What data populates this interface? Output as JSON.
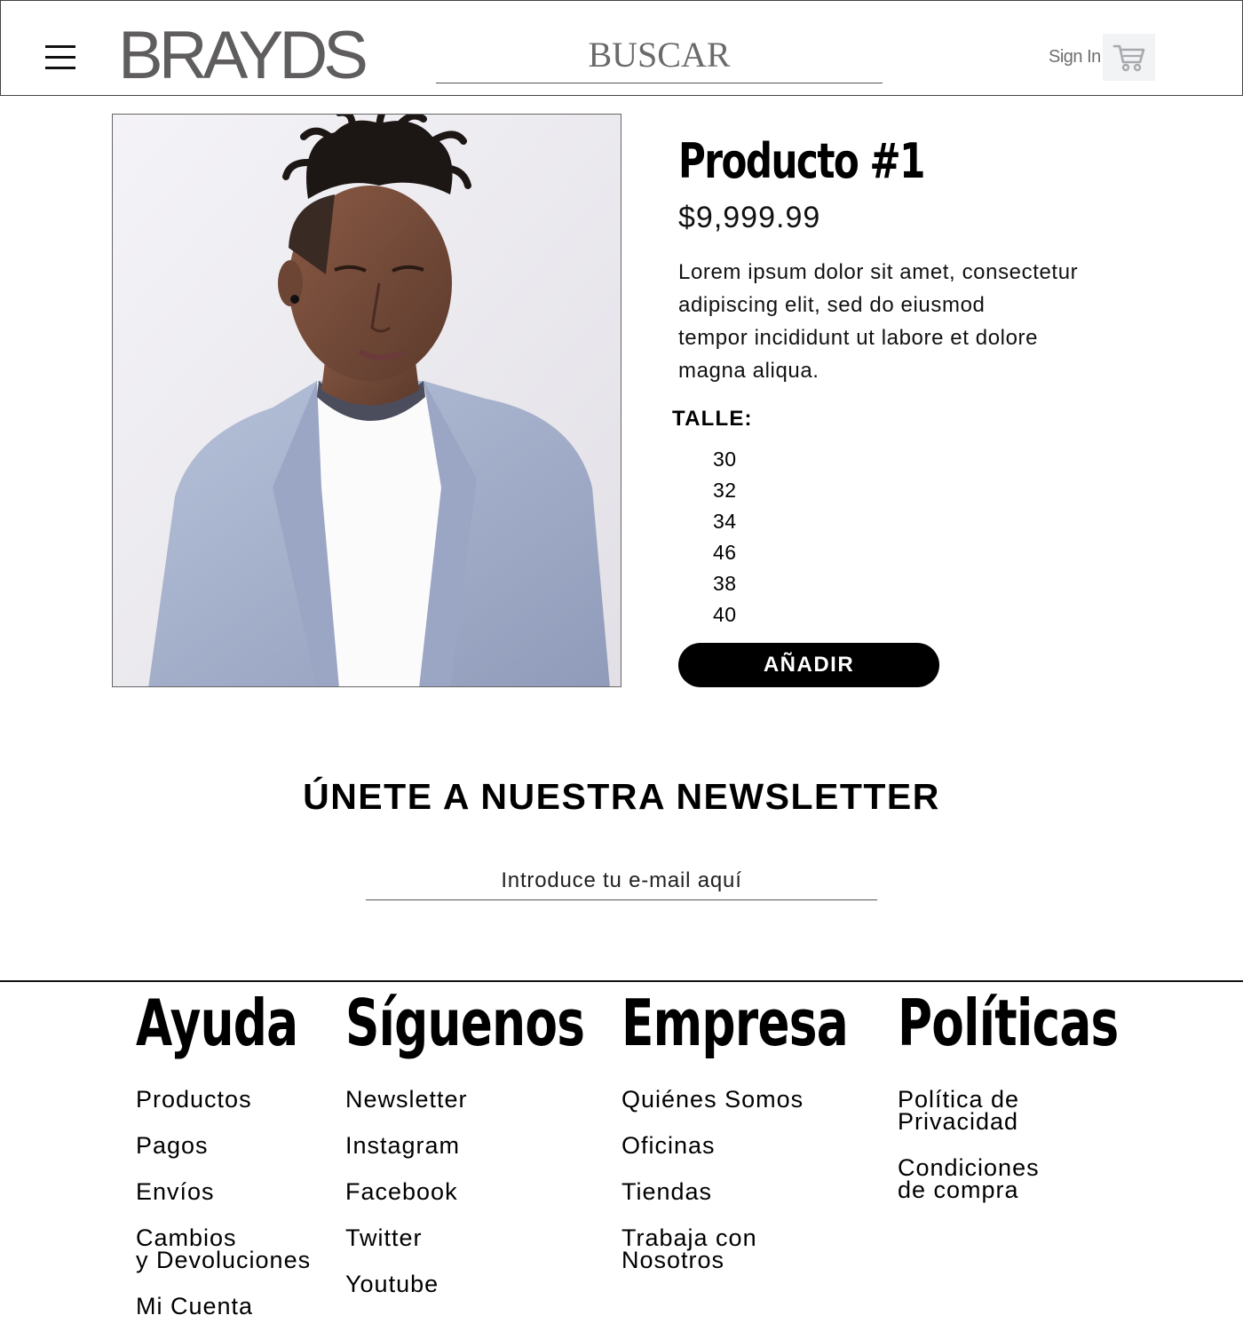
{
  "header": {
    "logo": "BRAYDS",
    "search_placeholder": "BUSCAR",
    "sign_in": "Sign In"
  },
  "icons": {
    "menu": "hamburger-menu-icon",
    "cart": "shopping-cart-icon"
  },
  "product": {
    "title": "Producto #1",
    "price": "$9,999.99",
    "description": "Lorem ipsum dolor sit amet, consectetur\nadipiscing elit, sed do eiusmod\ntempor incididunt ut labore et dolore\nmagna aliqua.",
    "size_label": "TALLE:",
    "sizes": [
      "30",
      "32",
      "34",
      "46",
      "38",
      "40"
    ],
    "add_button": "AÑADIR"
  },
  "newsletter": {
    "title": "ÚNETE A NUESTRA NEWSLETTER",
    "email_placeholder": "Introduce tu e-mail aquí"
  },
  "footer": {
    "columns": [
      {
        "heading": "Ayuda",
        "links": [
          "Productos",
          "Pagos",
          "Envíos",
          "Cambios\ny Devoluciones",
          "Mi Cuenta"
        ]
      },
      {
        "heading": "Síguenos",
        "links": [
          "Newsletter",
          "Instagram",
          "Facebook",
          "Twitter",
          "Youtube"
        ]
      },
      {
        "heading": "Empresa",
        "links": [
          "Quiénes Somos",
          "Oficinas",
          "Tiendas",
          "Trabaja con\nNosotros"
        ]
      },
      {
        "heading": "Políticas",
        "links": [
          "Política de\nPrivacidad",
          "Condiciones\nde compra"
        ]
      }
    ]
  },
  "colors": {
    "logo": "#5f5d5e",
    "button_bg": "#000000",
    "button_text": "#ffffff",
    "cart_bg": "#f1f3f5"
  }
}
